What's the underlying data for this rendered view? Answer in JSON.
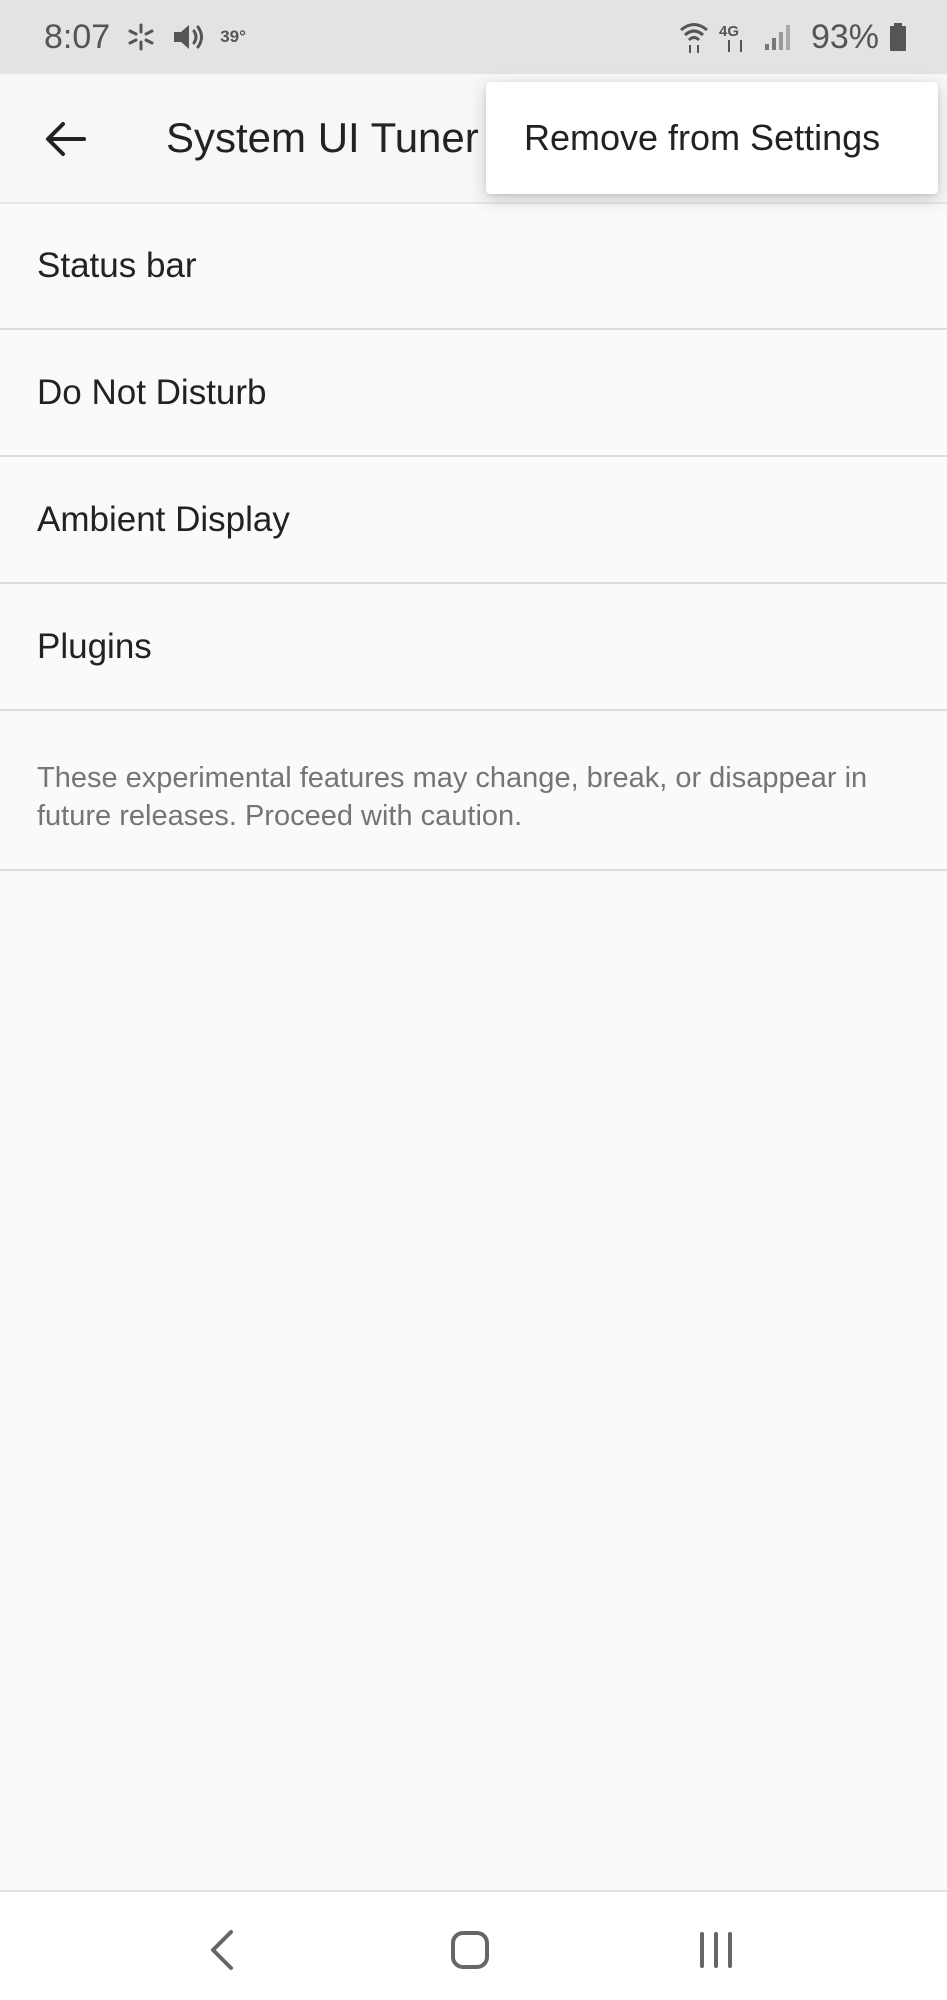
{
  "status_bar": {
    "time": "8:07",
    "temperature": "39°",
    "battery_percent": "93%",
    "network_label": "4G",
    "icons": [
      "sparkle-icon",
      "volume-icon",
      "wifi-icon",
      "lte-icon",
      "signal-icon",
      "battery-icon"
    ]
  },
  "app_bar": {
    "title": "System UI Tuner"
  },
  "overflow_menu": {
    "items": [
      {
        "label": "Remove from Settings"
      }
    ]
  },
  "settings": {
    "items": [
      {
        "label": "Status bar"
      },
      {
        "label": "Do Not Disturb"
      },
      {
        "label": "Ambient Display"
      },
      {
        "label": "Plugins"
      }
    ],
    "footer_note": "These experimental features may change, break, or disappear in future releases. Proceed with caution."
  },
  "navigation_bar": {
    "buttons": [
      "back",
      "home",
      "recents"
    ]
  },
  "colors": {
    "status_bar_bg": "#e3e3e3",
    "app_bg": "#fafafa",
    "divider": "#dcdcdc",
    "footer_text": "#757575"
  }
}
